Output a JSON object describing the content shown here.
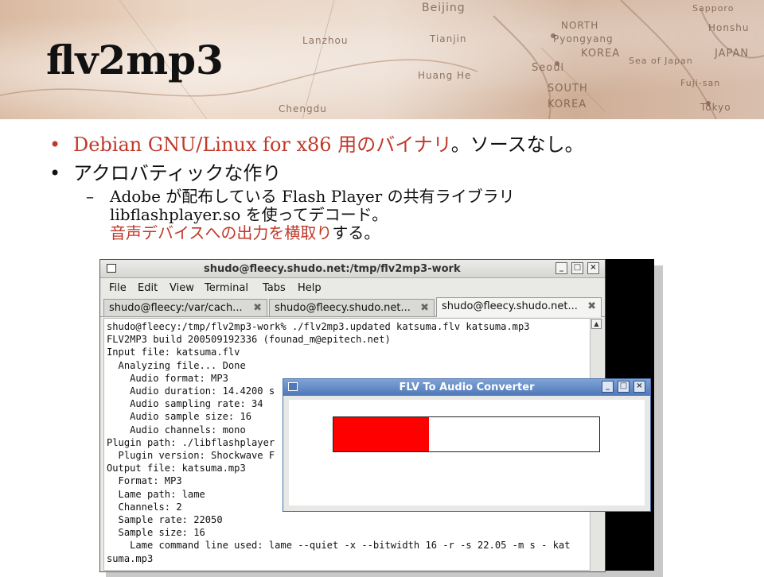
{
  "slide": {
    "title": "flv2mp3",
    "bullet1": {
      "highlight": "Debian GNU/Linux for x86 用のバイナリ",
      "rest": "。ソースなし。"
    },
    "bullet2": "アクロバティックな作り",
    "sub_line1": "Adobe が配布している Flash Player の共有ライブラリ",
    "sub_line2": "libflashplayer.so を使ってデコード。",
    "sub_line3_highlight": "音声デバイスへの出力を横取り",
    "sub_line3_rest": "する。",
    "map_labels": [
      "Beijing",
      "NORTH",
      "Pyongyang",
      "KOREA",
      "Seoul",
      "SOUTH",
      "KOREA",
      "Tianjin",
      "Lanzhou",
      "Huang He",
      "Chengdu",
      "JAPAN",
      "Honshu",
      "Tokyo",
      "Fuji-san",
      "Sea of Japan",
      "Sapporo"
    ]
  },
  "terminal": {
    "title": "shudo@fleecy.shudo.net:/tmp/flv2mp3-work",
    "menu": [
      "File",
      "Edit",
      "View",
      "Terminal",
      "Tabs",
      "Help"
    ],
    "tabs": [
      "shudo@fleecy:/var/cach...",
      "shudo@fleecy.shudo.net...",
      "shudo@fleecy.shudo.net..."
    ],
    "active_tab": 2,
    "lines": [
      "shudo@fleecy:/tmp/flv2mp3-work% ./flv2mp3.updated katsuma.flv katsuma.mp3",
      "FLV2MP3 build 200509192336 (founad_m@epitech.net)",
      "Input file: katsuma.flv",
      "  Analyzing file... Done",
      "    Audio format: MP3",
      "    Audio duration: 14.4200 s",
      "    Audio sampling rate: 34",
      "    Audio sample size: 16",
      "    Audio channels: mono",
      "Plugin path: ./libflashplayer",
      "  Plugin version: Shockwave F",
      "Output file: katsuma.mp3",
      "  Format: MP3",
      "  Lame path: lame",
      "  Channels: 2",
      "  Sample rate: 22050",
      "  Sample size: 16",
      "    Lame command line used: lame --quiet -x --bitwidth 16 -r -s 22.05 -m s - kat",
      "suma.mp3"
    ]
  },
  "dialog": {
    "title": "FLV To Audio Converter",
    "progress": 0.36,
    "progress_color": "#ff0000"
  },
  "colors": {
    "accent_red": "#c0392b",
    "dialog_title": "#4f78b8"
  }
}
